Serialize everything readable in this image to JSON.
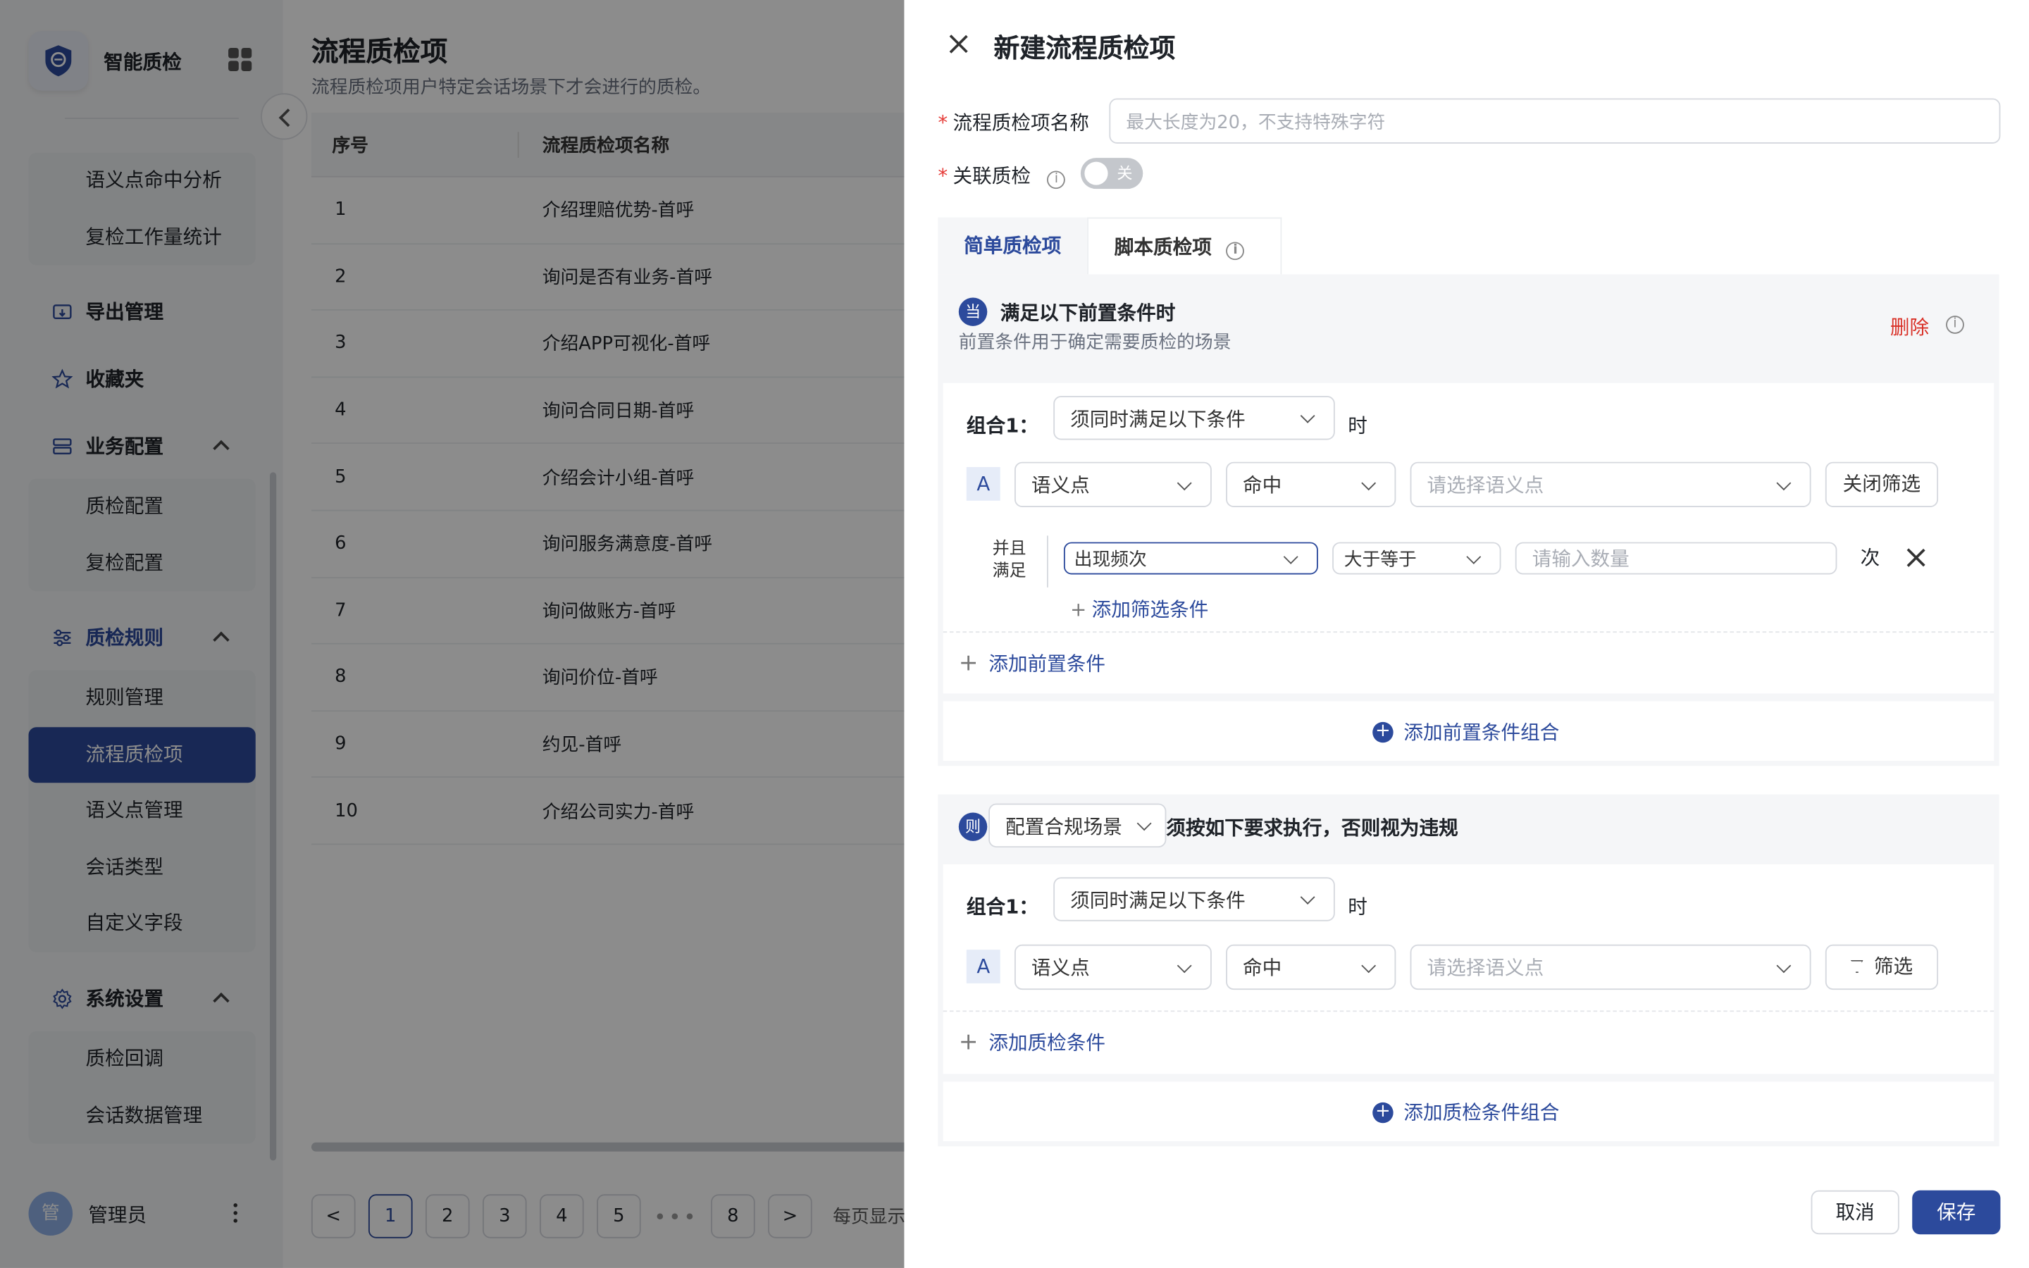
{
  "brand": {
    "name": "智能质检"
  },
  "sidebar": {
    "sub_analytics": [
      "语义点命中分析",
      "复检工作量统计"
    ],
    "export": "导出管理",
    "favorites": "收藏夹",
    "biz_config": {
      "label": "业务配置",
      "items": [
        "质检配置",
        "复检配置"
      ]
    },
    "rules": {
      "label": "质检规则",
      "items": [
        "规则管理",
        "流程质检项",
        "语义点管理",
        "会话类型",
        "自定义字段"
      ]
    },
    "system": {
      "label": "系统设置",
      "items": [
        "质检回调",
        "会话数据管理"
      ]
    },
    "user": {
      "avatar": "管",
      "name": "管理员"
    }
  },
  "main": {
    "title": "流程质检项",
    "desc": "流程质检项用户特定会话场景下才会进行的质检。",
    "columns": [
      "序号",
      "流程质检项名称"
    ],
    "rows": [
      [
        "1",
        "介绍理赔优势-首呼"
      ],
      [
        "2",
        "询问是否有业务-首呼"
      ],
      [
        "3",
        "介绍APP可视化-首呼"
      ],
      [
        "4",
        "询问合同日期-首呼"
      ],
      [
        "5",
        "介绍会计小组-首呼"
      ],
      [
        "6",
        "询问服务满意度-首呼"
      ],
      [
        "7",
        "询问做账方-首呼"
      ],
      [
        "8",
        "询问价位-首呼"
      ],
      [
        "9",
        "约见-首呼"
      ],
      [
        "10",
        "介绍公司实力-首呼"
      ]
    ],
    "pager": {
      "prev": "<",
      "pages": [
        "1",
        "2",
        "3",
        "4",
        "5"
      ],
      "dots": "•••",
      "last": "8",
      "next": ">",
      "per_page": "每页显示"
    }
  },
  "drawer": {
    "title": "新建流程质检项",
    "name_label": "流程质检项名称",
    "name_placeholder": "最大长度为20，不支持特殊字符",
    "link_label": "关联质检",
    "toggle_off": "关",
    "tabs": [
      "简单质检项",
      "脚本质检项"
    ],
    "pre": {
      "badge": "当",
      "title": "满足以下前置条件时",
      "desc": "前置条件用于确定需要质检的场景",
      "delete": "删除",
      "group_label": "组合1：",
      "group_mode": "须同时满足以下条件",
      "group_suffix": "时",
      "row_badge": "A",
      "field": "语义点",
      "op": "命中",
      "semantic_placeholder": "请选择语义点",
      "filter_btn": "关闭筛选",
      "and_label_1": "并且",
      "and_label_2": "满足",
      "filter_field": "出现频次",
      "filter_op": "大于等于",
      "filter_count_placeholder": "请输入数量",
      "filter_unit": "次",
      "add_filter": "添加筛选条件",
      "add_cond": "添加前置条件",
      "add_group": "添加前置条件组合"
    },
    "then": {
      "badge": "则",
      "scene": "配置合规场景",
      "rule_text": "须按如下要求执行，否则视为违规",
      "group_label": "组合1：",
      "group_mode": "须同时满足以下条件",
      "group_suffix": "时",
      "row_badge": "A",
      "field": "语义点",
      "op": "命中",
      "semantic_placeholder": "请选择语义点",
      "filter_btn": "筛选",
      "add_cond": "添加质检条件",
      "add_group": "添加质检条件组合"
    },
    "cancel": "取消",
    "save": "保存"
  }
}
